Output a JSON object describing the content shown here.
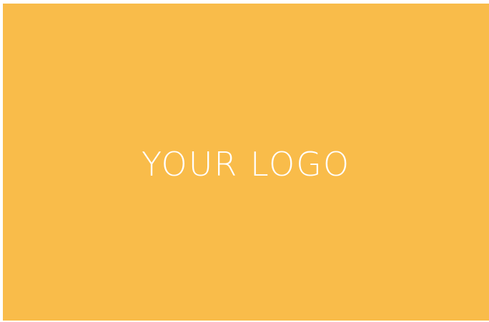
{
  "logo": {
    "text": "YOUR LOGO",
    "background_color": "#F9BC4A",
    "text_color": "#FFFFFF"
  }
}
